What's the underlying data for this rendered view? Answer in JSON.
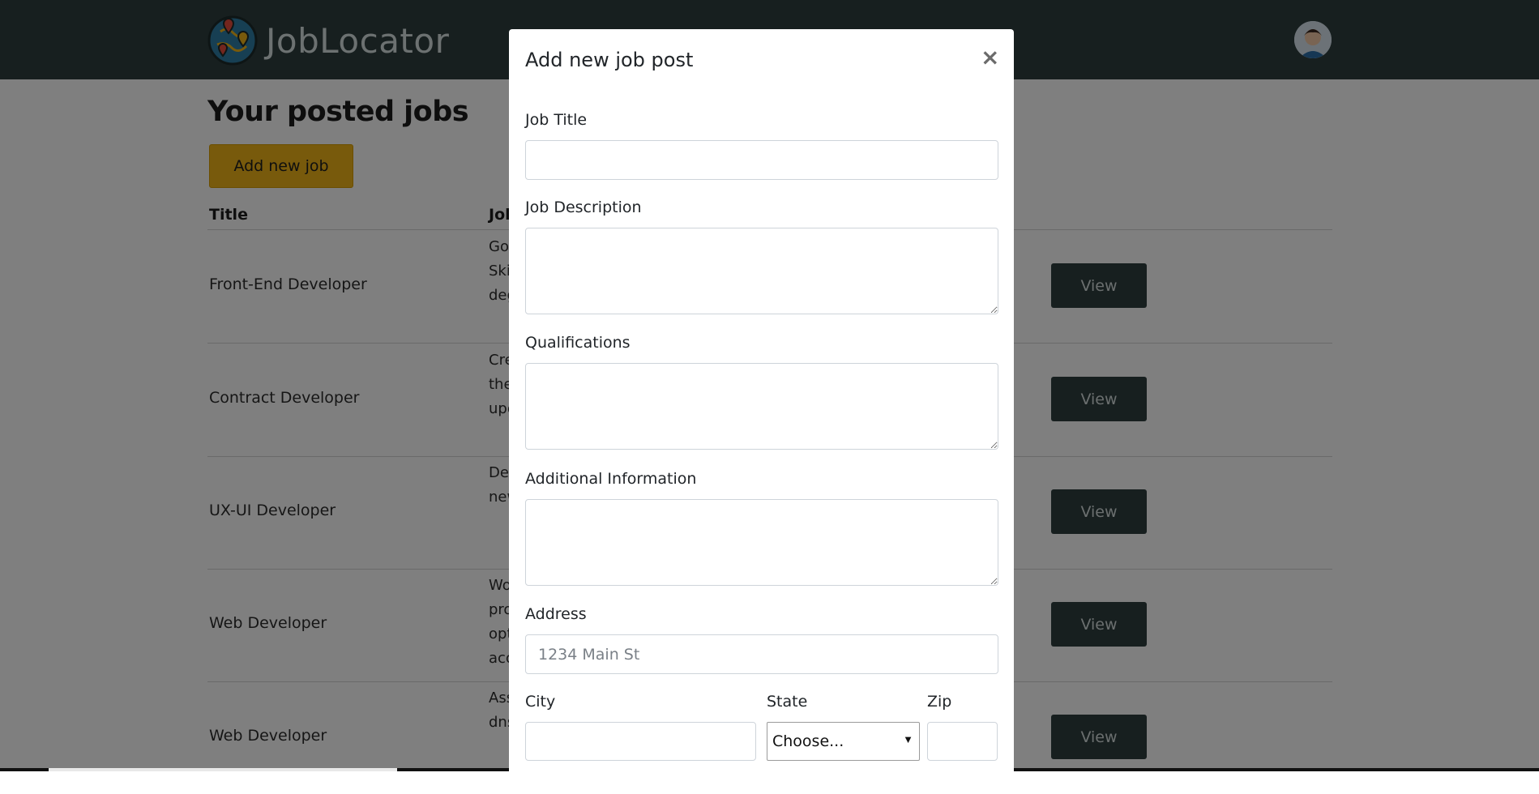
{
  "nav": {
    "brand": "JobLocator"
  },
  "page": {
    "title": "Your posted jobs",
    "add_button": "Add new job",
    "table": {
      "headers": [
        "Title",
        "Job"
      ],
      "rows": [
        {
          "title": "Front-End Developer",
          "description": "Goo\nSki\ndeg",
          "action": "View"
        },
        {
          "title": "Contract Developer",
          "description": "Cre\nthe\nupo",
          "action": "View"
        },
        {
          "title": "UX-UI Developer",
          "description": "Des\nnew",
          "action": "View"
        },
        {
          "title": "Web Developer",
          "description": "Wo\npro\nopt\nacc",
          "action": "View"
        },
        {
          "title": "Web Developer",
          "description": "Ass\ndns",
          "action": "View"
        }
      ]
    }
  },
  "modal": {
    "title": "Add new job post",
    "close": "×",
    "job_title_label": "Job Title",
    "job_title_value": "",
    "job_description_label": "Job Description",
    "qualifications_label": "Qualifications",
    "additional_info_label": "Additional Information",
    "address_label": "Address",
    "address_placeholder": "1234 Main St",
    "city_label": "City",
    "state_label": "State",
    "state_selected": "Choose...",
    "zip_label": "Zip"
  },
  "icons": {
    "logo": "globe-map-pin-logo-icon",
    "avatar": "user-avatar-icon",
    "close": "close-icon",
    "select_arrow": "triangle-down-icon"
  },
  "colors": {
    "navbar": "#2e3f3f",
    "accent": "#f0b418",
    "view_button": "#2e3f3f"
  }
}
